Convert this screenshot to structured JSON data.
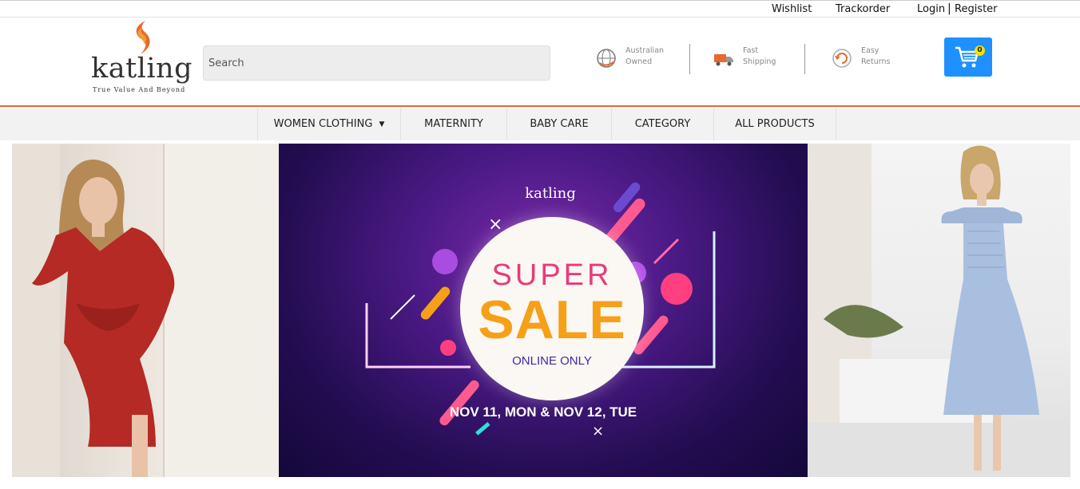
{
  "topbar": {
    "wishlist": "Wishlist",
    "trackorder": "Trackorder",
    "login": "Login",
    "separator": "|",
    "register": "Register"
  },
  "brand": {
    "name": "katling",
    "tagline": "True Value And Beyond",
    "accent_color": "#e8692d"
  },
  "search": {
    "placeholder": "Search"
  },
  "features": [
    {
      "line1": "Australian",
      "line2": "Owned",
      "icon": "globe-icon"
    },
    {
      "line1": "Fast",
      "line2": "Shipping",
      "icon": "truck-icon"
    },
    {
      "line1": "Easy",
      "line2": "Returns",
      "icon": "returns-icon"
    }
  ],
  "cart": {
    "count": "0",
    "color": "#1e90ff"
  },
  "nav": {
    "items": [
      {
        "label": "WOMEN CLOTHING",
        "has_caret": true
      },
      {
        "label": "MATERNITY"
      },
      {
        "label": "BABY CARE"
      },
      {
        "label": "CATEGORY"
      },
      {
        "label": "ALL PRODUCTS"
      }
    ],
    "caret": "▼"
  },
  "banner": {
    "logo_text": "katling",
    "super": "SUPER",
    "sale": "SALE",
    "online": "ONLINE ONLY",
    "dates": "NOV 11, MON & NOV 12, TUE"
  }
}
